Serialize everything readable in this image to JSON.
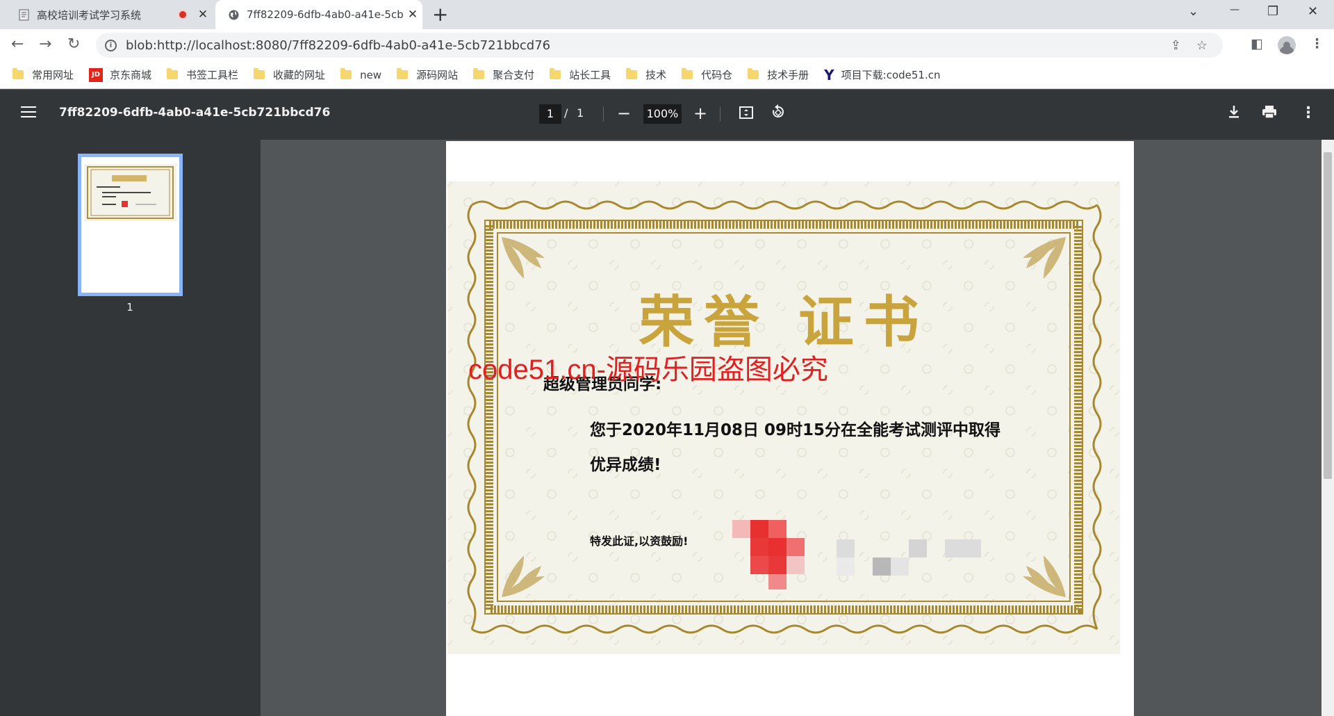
{
  "tabs": [
    {
      "title": "高校培训考试学习系统",
      "close": "✕"
    },
    {
      "title": "7ff82209-6dfb-4ab0-a41e-5cb",
      "close": "✕"
    }
  ],
  "new_tab": "+",
  "window_controls": {
    "dropdown": "⌄",
    "minimize": "—",
    "restore": "❐",
    "close": "✕"
  },
  "address": {
    "url": "blob:http://localhost:8080/7ff82209-6dfb-4ab0-a41e-5cb721bbcd76"
  },
  "bookmarks": [
    {
      "label": "常用网址",
      "icon": "folder-icon"
    },
    {
      "label": "京东商城",
      "icon": "jd-icon"
    },
    {
      "label": "书签工具栏",
      "icon": "folder-icon"
    },
    {
      "label": "收藏的网址",
      "icon": "folder-icon"
    },
    {
      "label": "new",
      "icon": "folder-icon"
    },
    {
      "label": "源码网站",
      "icon": "folder-icon"
    },
    {
      "label": "聚合支付",
      "icon": "folder-icon"
    },
    {
      "label": "站长工具",
      "icon": "folder-icon"
    },
    {
      "label": "技术",
      "icon": "folder-icon"
    },
    {
      "label": "代码仓",
      "icon": "folder-icon"
    },
    {
      "label": "技术手册",
      "icon": "folder-icon"
    },
    {
      "label": "项目下载:code51.cn",
      "icon": "y-logo-icon"
    }
  ],
  "pdf": {
    "title": "7ff82209-6dfb-4ab0-a41e-5cb721bbcd76",
    "page_current": "1",
    "page_sep": "/",
    "page_total": "1",
    "zoom": "100%",
    "thumbnail_label": "1"
  },
  "certificate": {
    "heading": "荣誉 证书",
    "watermark": "code51.cn-源码乐园盗图必究",
    "recipient": "超级管理员同学:",
    "body_line1": "您于2020年11月08日 09时15分在全能考试测评中取得",
    "body_line2": "优异成绩!",
    "closing": "特发此证,以资鼓励!"
  },
  "colors": {
    "gold": "#b08d3a",
    "watermark_red": "#e02020",
    "toolbar_dark": "#323639",
    "viewer_bg": "#525659"
  }
}
